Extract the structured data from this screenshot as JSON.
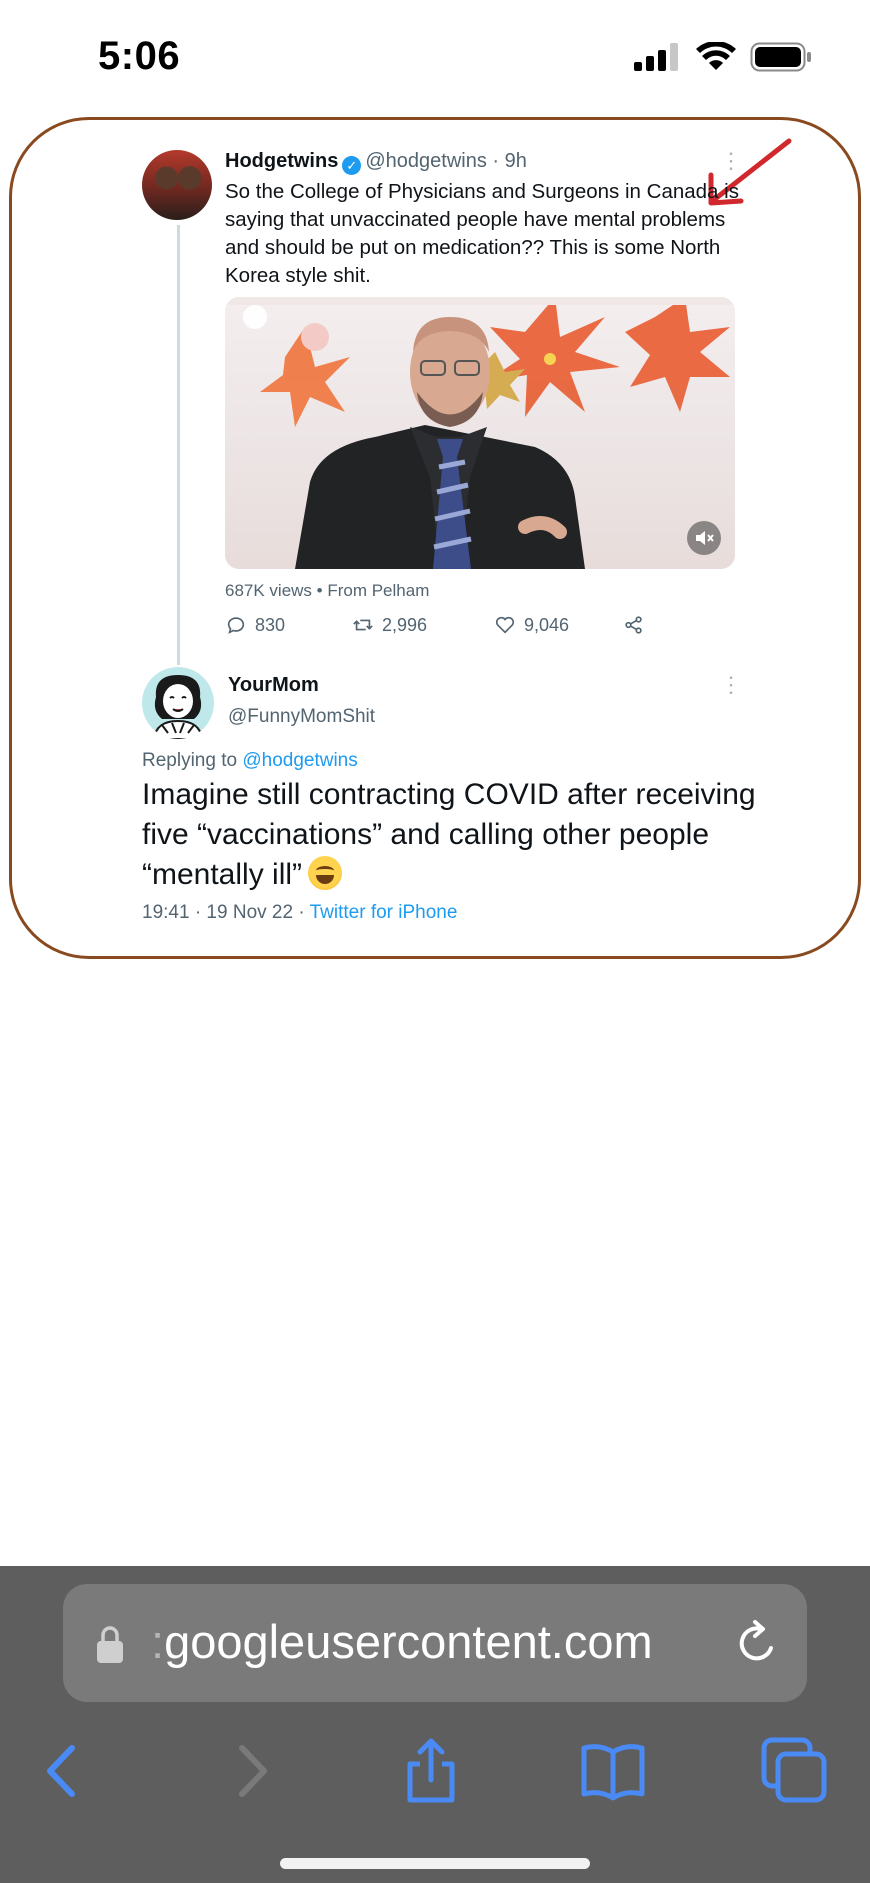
{
  "status_bar": {
    "time": "5:06"
  },
  "tweet1": {
    "name": "Hodgetwins",
    "handle_time": "@hodgetwins · 9h",
    "text": "So the College of Physicians and Surgeons in Canada is saying that unvaccinated people have mental problems and should be put on medication?? This is some North Korea style shit.",
    "views": "687K views • From Pelham",
    "replies": "830",
    "retweets": "2,996",
    "likes": "9,046"
  },
  "tweet2": {
    "name": "YourMom",
    "handle": "@FunnyMomShit",
    "replying_prefix": "Replying to",
    "replying_to": "@hodgetwins",
    "text": "Imagine still contracting COVID after receiving five “vaccinations” and calling other people “mentally ill”",
    "meta": "19:41 · 19 Nov 22 ·",
    "source": "Twitter for iPhone"
  },
  "browser": {
    "url_prefix": ":",
    "url": "googleusercontent.com"
  },
  "colors": {
    "card_border": "#8a4a1f",
    "link_blue": "#1d9bf0",
    "annotation_red": "#d0282d",
    "toolbar_blue": "#4a8af4",
    "toolbar_bg": "#5e5e5e"
  },
  "icons": {
    "status": [
      "signal-icon",
      "wifi-icon",
      "battery-icon"
    ],
    "tweet_actions": [
      "reply-icon",
      "retweet-icon",
      "like-icon",
      "share-icon"
    ],
    "toolbar": [
      "back-icon",
      "forward-icon",
      "share-icon",
      "bookmarks-icon",
      "tabs-icon"
    ]
  }
}
